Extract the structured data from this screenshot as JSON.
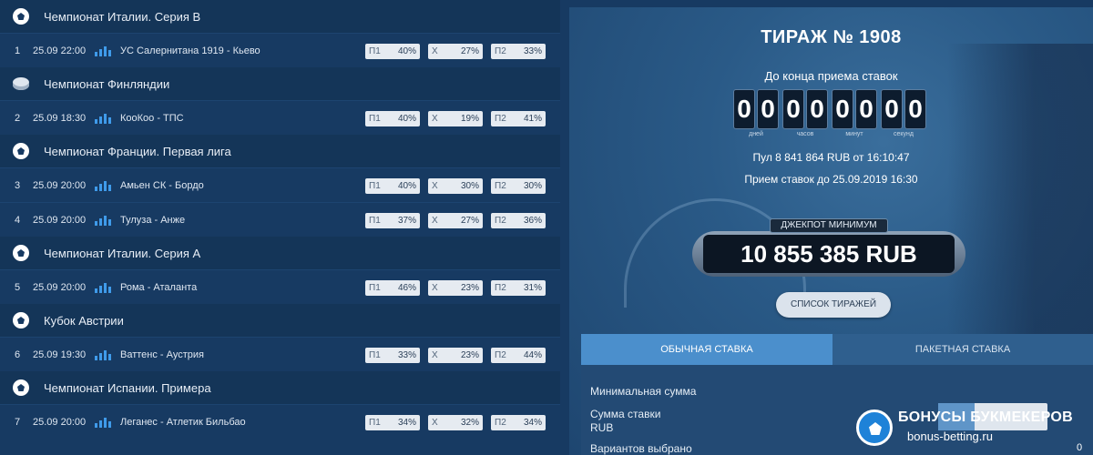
{
  "left": {
    "blocks": [
      {
        "league": "Чемпионат Италии. Серия B",
        "icon": "football-icon",
        "matches": [
          {
            "num": "1",
            "time": "25.09 22:00",
            "teams": "УС Салернитана 1919 - Кьево",
            "p1": "40%",
            "x": "27%",
            "p2": "33%"
          }
        ]
      },
      {
        "league": "Чемпионат Финляндии",
        "icon": "hockey-puck-icon",
        "matches": [
          {
            "num": "2",
            "time": "25.09 18:30",
            "teams": "КооКоо - ТПС",
            "p1": "40%",
            "x": "19%",
            "p2": "41%"
          }
        ]
      },
      {
        "league": "Чемпионат Франции. Первая лига",
        "icon": "football-icon",
        "matches": [
          {
            "num": "3",
            "time": "25.09 20:00",
            "teams": "Амьен СК - Бордо",
            "p1": "40%",
            "x": "30%",
            "p2": "30%"
          },
          {
            "num": "4",
            "time": "25.09 20:00",
            "teams": "Тулуза - Анже",
            "p1": "37%",
            "x": "27%",
            "p2": "36%"
          }
        ]
      },
      {
        "league": "Чемпионат Италии. Серия А",
        "icon": "football-icon",
        "matches": [
          {
            "num": "5",
            "time": "25.09 20:00",
            "teams": "Рома - Аталанта",
            "p1": "46%",
            "x": "23%",
            "p2": "31%"
          }
        ]
      },
      {
        "league": "Кубок Австрии",
        "icon": "football-icon",
        "matches": [
          {
            "num": "6",
            "time": "25.09 19:30",
            "teams": "Ваттенс - Аустрия",
            "p1": "33%",
            "x": "23%",
            "p2": "44%"
          }
        ]
      },
      {
        "league": "Чемпионат Испании. Примера",
        "icon": "football-icon",
        "matches": [
          {
            "num": "7",
            "time": "25.09 20:00",
            "teams": "Леганес - Атлетик Бильбао",
            "p1": "34%",
            "x": "32%",
            "p2": "34%"
          }
        ]
      }
    ],
    "labels": {
      "p1": "П1",
      "x": "Х",
      "p2": "П2"
    }
  },
  "draw": {
    "title": "ТИРАЖ № 1908",
    "until": "До конца приема ставок",
    "timer": [
      {
        "digits": [
          "0",
          "0"
        ],
        "label": "дней"
      },
      {
        "digits": [
          "0",
          "0"
        ],
        "label": "часов"
      },
      {
        "digits": [
          "0",
          "0"
        ],
        "label": "минут"
      },
      {
        "digits": [
          "0",
          "0"
        ],
        "label": "секунд"
      }
    ],
    "pool": "Пул 8 841 864 RUB от 16:10:47",
    "accept": "Прием ставок до 25.09.2019 16:30",
    "jackpot_label": "ДЖЕКПОТ МИНИМУМ",
    "jackpot_value": "10 855 385 RUB",
    "draws_button": "СПИСОК ТИРАЖЕЙ"
  },
  "tabs": {
    "regular": "ОБЫЧНАЯ СТАВКА",
    "package": "ПАКЕТНАЯ СТАВКА"
  },
  "form": {
    "min_sum": "Минимальная сумма",
    "bet_sum_line1": "Сумма ставки",
    "bet_sum_line2": "RUB",
    "variants": "Вариантов выбрано",
    "variants_count": "0"
  },
  "watermark": {
    "line1": "БОНУСЫ БУКМЕКЕРОВ",
    "line2": "bonus-betting.ru"
  }
}
